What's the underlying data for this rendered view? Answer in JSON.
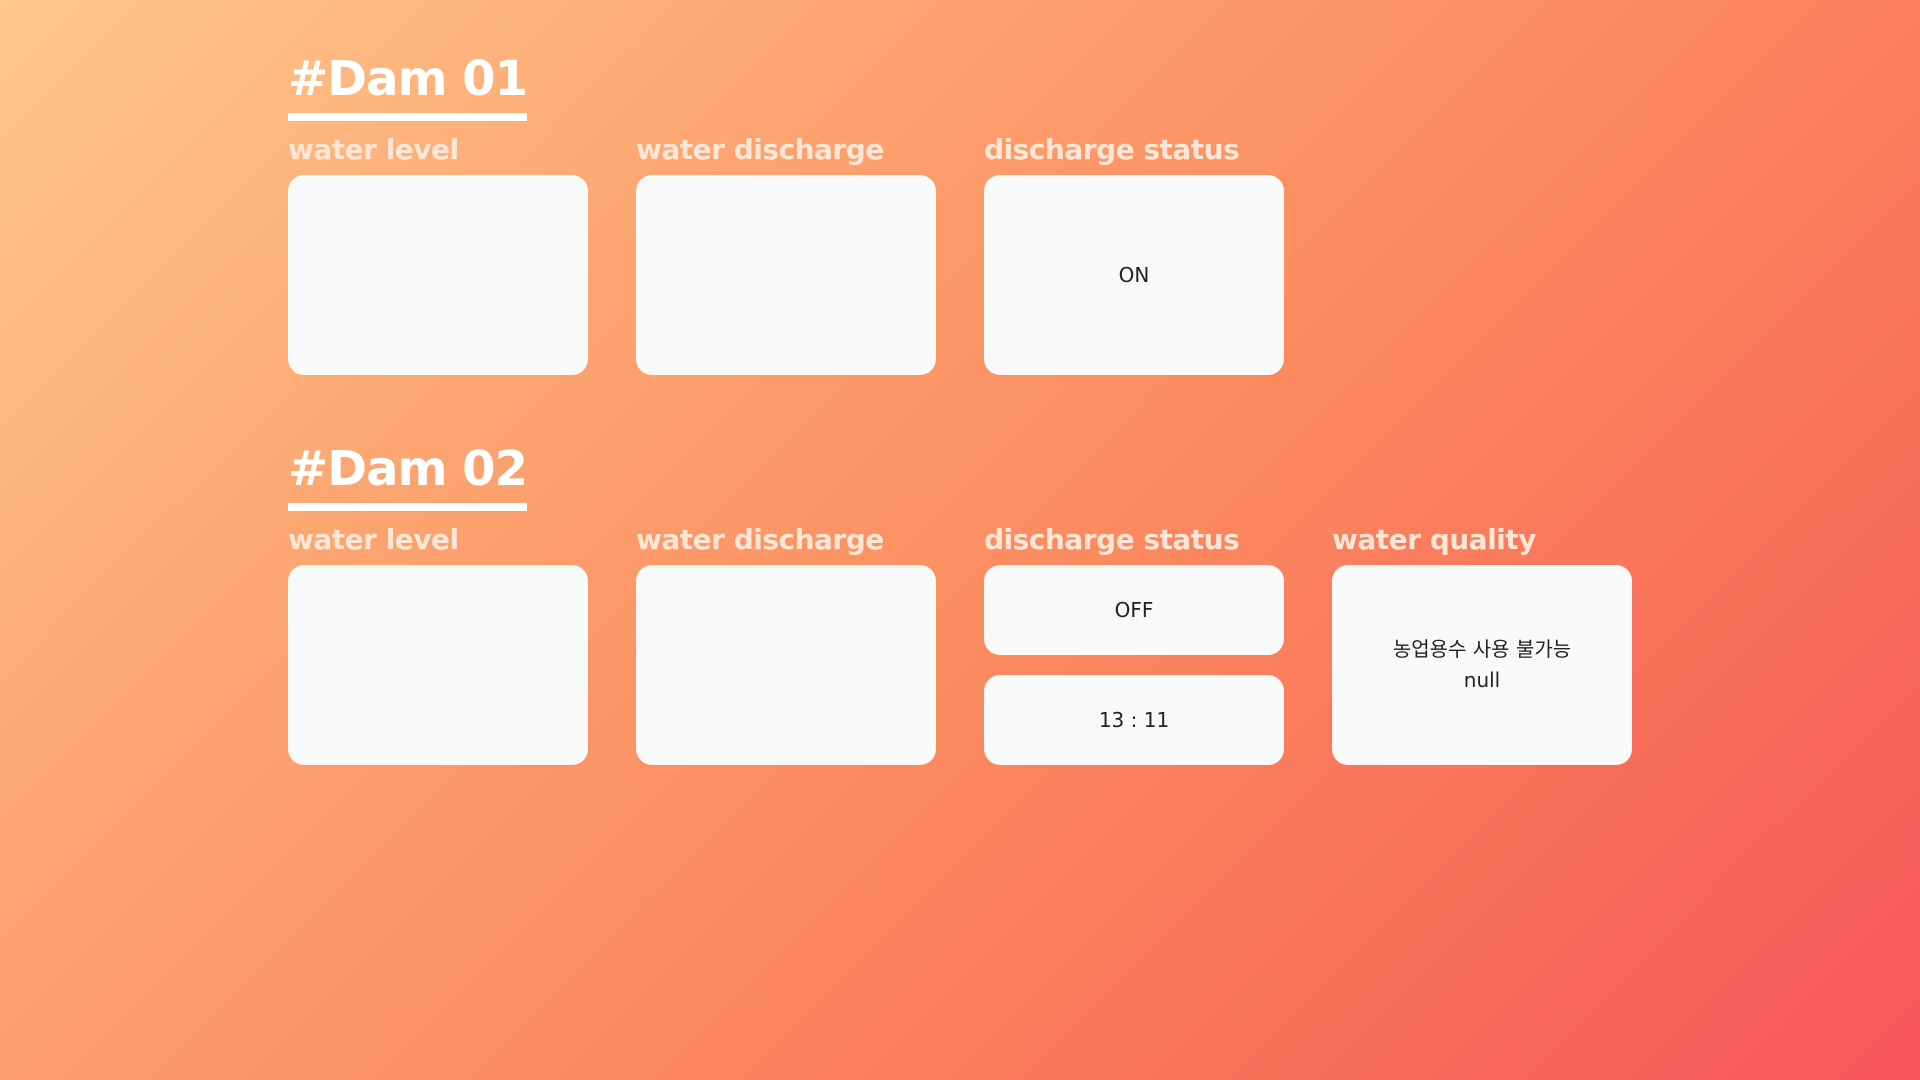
{
  "dams": [
    {
      "title": "#Dam 01",
      "water_level": {
        "label": "water level",
        "value": ""
      },
      "water_discharge": {
        "label": "water discharge",
        "value": ""
      },
      "discharge_status": {
        "label": "discharge status",
        "status": "ON"
      }
    },
    {
      "title": "#Dam 02",
      "water_level": {
        "label": "water level",
        "value": ""
      },
      "water_discharge": {
        "label": "water discharge",
        "value": ""
      },
      "discharge_status": {
        "label": "discharge status",
        "status": "OFF",
        "time": "13 : 11"
      },
      "water_quality": {
        "label": "water quality",
        "message": "농업용수 사용 불가능",
        "value": "null"
      }
    }
  ]
}
